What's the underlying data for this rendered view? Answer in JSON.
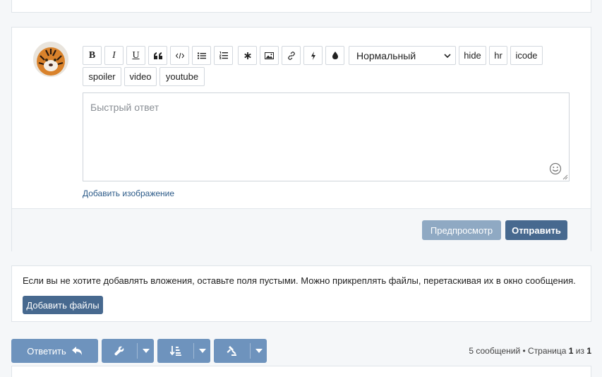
{
  "toolbar": {
    "buttons": [
      {
        "name": "bold-icon",
        "label": "B"
      },
      {
        "name": "italic-icon",
        "label": "I"
      },
      {
        "name": "underline-icon",
        "label": "U"
      },
      {
        "name": "quote-icon",
        "label": ""
      },
      {
        "name": "code-icon",
        "label": ""
      },
      {
        "name": "bullet-list-icon",
        "label": ""
      },
      {
        "name": "numbered-list-icon",
        "label": ""
      },
      {
        "name": "asterisk-icon",
        "label": ""
      },
      {
        "name": "image-icon",
        "label": ""
      },
      {
        "name": "link-icon",
        "label": ""
      },
      {
        "name": "lightning-icon",
        "label": ""
      },
      {
        "name": "color-drop-icon",
        "label": ""
      }
    ],
    "font_size_select": "Нормальный",
    "text_buttons": [
      "hide",
      "hr",
      "icode",
      "spoiler",
      "video",
      "youtube"
    ]
  },
  "editor": {
    "placeholder": "Быстрый ответ"
  },
  "add_image_link": "Добавить изображение",
  "actions": {
    "preview_label": "Предпросмотр",
    "send_label": "Отправить"
  },
  "attachments": {
    "hint": "Если вы не хотите добавлять вложения, оставьте поля пустыми. Можно прикреплять файлы, перетаскивая их в окно сообщения.",
    "add_files_label": "Добавить файлы"
  },
  "bottom": {
    "reply_label": "Ответить",
    "pagination": {
      "count_text": "5 сообщений • Страница ",
      "current": "1",
      "of_text": " из ",
      "total": "1"
    }
  },
  "colors": {
    "primary": "#47698f",
    "primary_light": "#6e93bd",
    "preview_disabled": "#8fa9c3"
  }
}
